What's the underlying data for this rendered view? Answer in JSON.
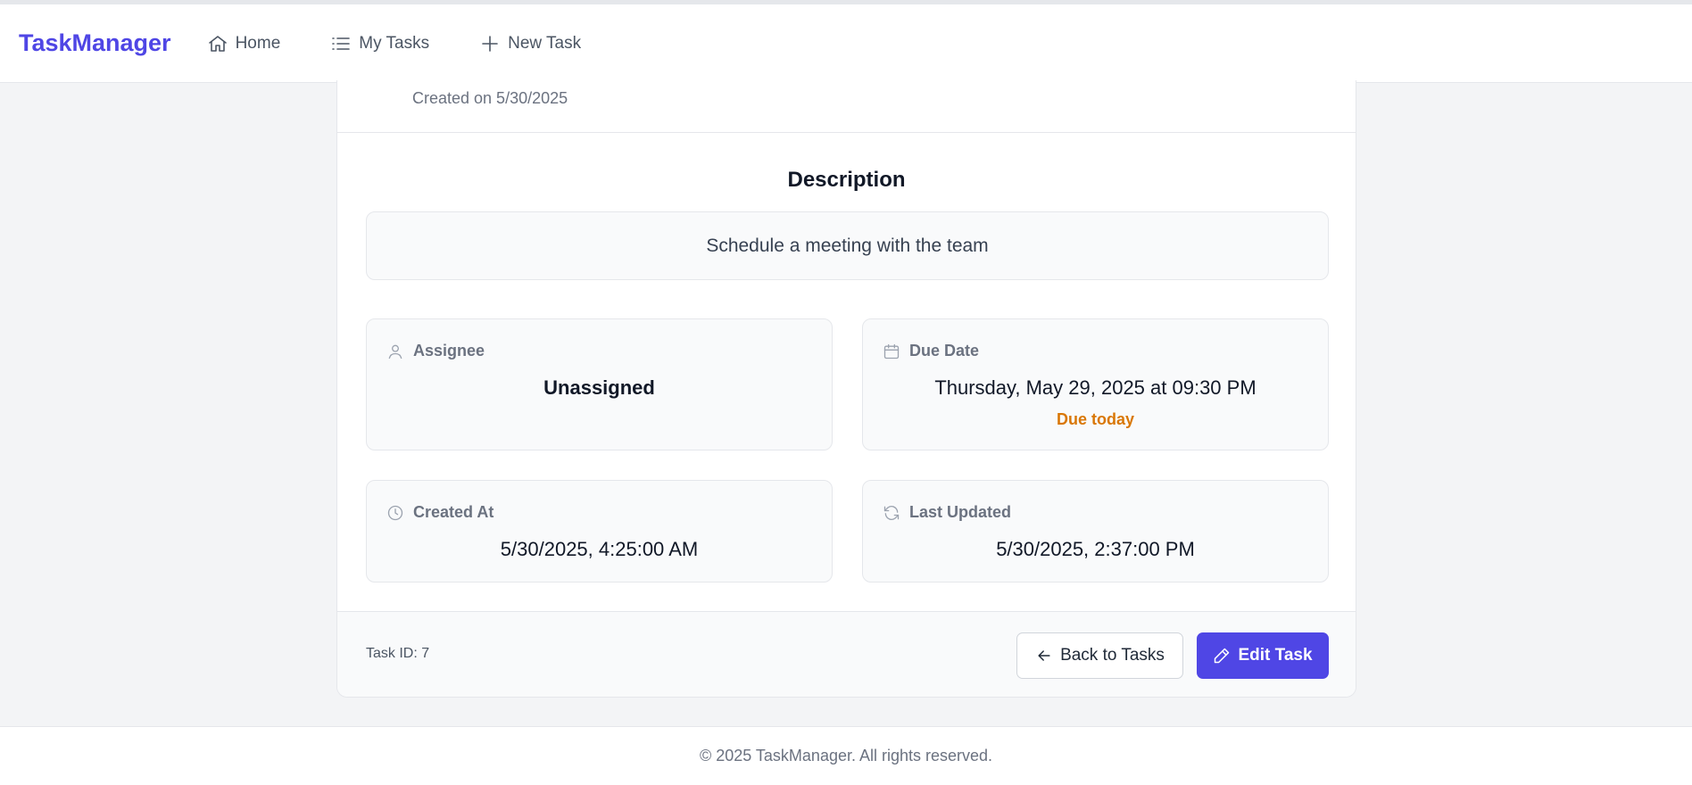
{
  "nav": {
    "brand": "TaskManager",
    "items": [
      {
        "label": "Home",
        "icon": "home-icon"
      },
      {
        "label": "My Tasks",
        "icon": "list-icon"
      },
      {
        "label": "New Task",
        "icon": "plus-icon"
      }
    ]
  },
  "task": {
    "created_on": "Created on 5/30/2025",
    "description_heading": "Description",
    "description": "Schedule a meeting with the team",
    "assignee": {
      "label": "Assignee",
      "value": "Unassigned",
      "icon": "user-icon"
    },
    "due_date": {
      "label": "Due Date",
      "value": "Thursday, May 29, 2025 at 09:30 PM",
      "status": "Due today",
      "icon": "calendar-icon",
      "status_color": "#d97706"
    },
    "created_at": {
      "label": "Created At",
      "value": "5/30/2025, 4:25:00 AM",
      "icon": "clock-icon"
    },
    "last_updated": {
      "label": "Last Updated",
      "value": "5/30/2025, 2:37:00 PM",
      "icon": "refresh-icon"
    },
    "id_text": "Task ID: 7",
    "back_button": "Back to Tasks",
    "edit_button": "Edit Task"
  },
  "footer": {
    "text": "© 2025 TaskManager. All rights reserved."
  },
  "colors": {
    "accent": "#4f46e5",
    "background": "#f3f4f6",
    "warning": "#d97706"
  }
}
